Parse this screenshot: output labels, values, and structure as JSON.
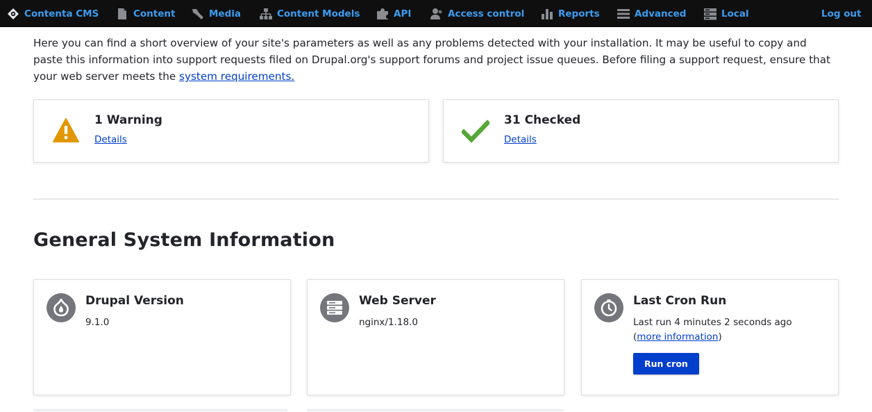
{
  "toolbar": {
    "site": {
      "label": "Contenta CMS",
      "icon": "drupal-logo-icon"
    },
    "items": [
      {
        "label": "Content",
        "icon": "file-icon"
      },
      {
        "label": "Media",
        "icon": "wrench-icon"
      },
      {
        "label": "Content Models",
        "icon": "sitemap-icon"
      },
      {
        "label": "API",
        "icon": "puzzle-icon"
      },
      {
        "label": "Access control",
        "icon": "people-icon"
      },
      {
        "label": "Reports",
        "icon": "bar-chart-icon"
      },
      {
        "label": "Advanced",
        "icon": "menu-icon"
      },
      {
        "label": "Local",
        "icon": "server-icon"
      }
    ],
    "logout_label": "Log out"
  },
  "intro": {
    "text": "Here you can find a short overview of your site's parameters as well as any problems detected with your installation. It may be useful to copy and paste this information into support requests filed on Drupal.org's support forums and project issue queues. Before filing a support request, ensure that your web server meets the ",
    "link_label": "system requirements."
  },
  "status": {
    "warning": {
      "title": "1 Warning",
      "link": "Details",
      "icon": "warning-icon",
      "color": "#e29700"
    },
    "checked": {
      "title": "31 Checked",
      "link": "Details",
      "icon": "checkmark-icon",
      "color": "#55a737"
    }
  },
  "general": {
    "title": "General System Information",
    "drupal": {
      "title": "Drupal Version",
      "value": "9.1.0",
      "icon": "drupal-drop-icon"
    },
    "webserver": {
      "title": "Web Server",
      "value": "nginx/1.18.0",
      "icon": "server-icon"
    },
    "cron": {
      "title": "Last Cron Run",
      "value": "Last run 4 minutes 2 seconds ago",
      "more_prefix": "(",
      "more_link": "more information",
      "more_suffix": ")",
      "button": "Run cron",
      "icon": "clock-icon"
    }
  },
  "colors": {
    "toolbar_bg": "#0f0f0f",
    "toolbar_link": "#3b9cf0",
    "link": "#003ecc",
    "button": "#003ecc",
    "icon_circle": "#75767b"
  }
}
